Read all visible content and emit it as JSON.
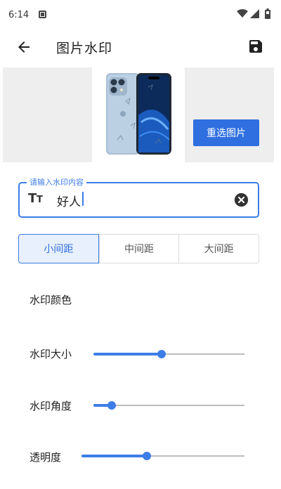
{
  "status_bar": {
    "time": "6:14",
    "icons": [
      "notification-icon",
      "wifi-icon",
      "signal-icon",
      "battery-icon"
    ]
  },
  "app_bar": {
    "title": "图片水印",
    "back_icon": "back-arrow-icon",
    "save_icon": "save-icon"
  },
  "preview": {
    "reselect_label": "重选图片",
    "watermark_text": "好人"
  },
  "input": {
    "label": "请输入水印内容",
    "value": "好人",
    "leading_icon": "text-size-icon",
    "trailing_icon": "clear-icon"
  },
  "spacing": {
    "options": [
      "小间距",
      "中间距",
      "大间距"
    ],
    "selected": "小间距"
  },
  "settings": {
    "color_label": "水印颜色",
    "size_label": "水印大小",
    "size_value": 0.45,
    "angle_label": "水印角度",
    "angle_value": 0.12,
    "opacity_label": "透明度",
    "opacity_value": 0.4
  },
  "colors": {
    "accent": "#3d7de8",
    "button": "#2f6fe0",
    "preview_bg": "#eeeeee",
    "track": "#bdbdbd"
  }
}
